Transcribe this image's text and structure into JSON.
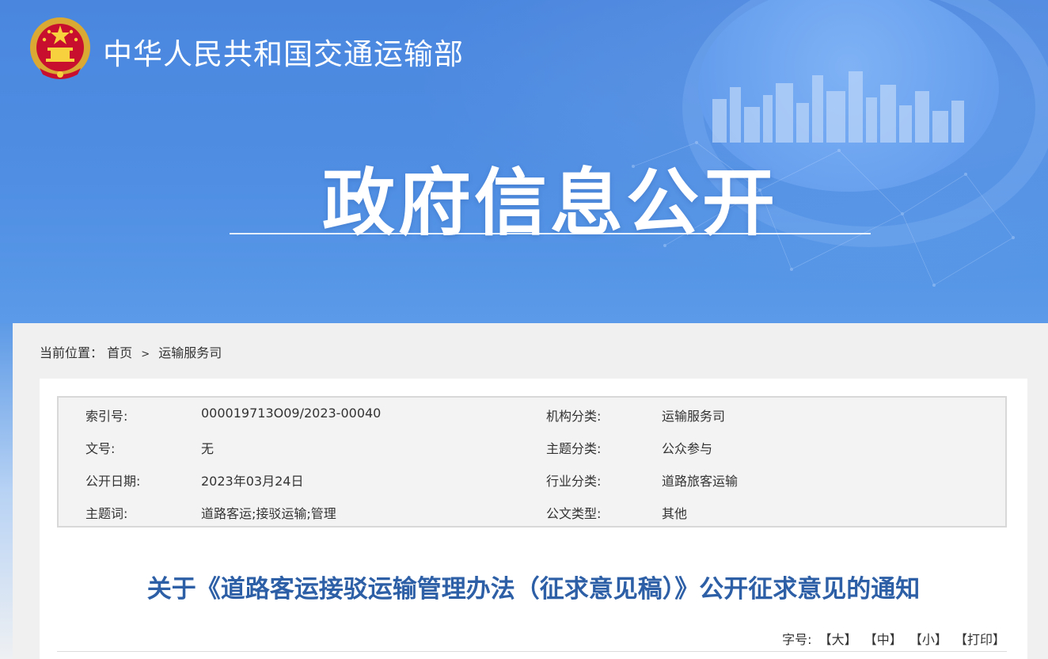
{
  "header": {
    "ministry_name": "中华人民共和国交通运输部",
    "banner_title": "政府信息公开",
    "emblem_icon": "national-emblem-icon",
    "colors": {
      "banner": "#4f8ee3",
      "title": "#2d5fa6"
    }
  },
  "breadcrumb": {
    "prefix": "当前位置：",
    "items": [
      "首页",
      "运输服务司"
    ],
    "separator": ">"
  },
  "metadata": {
    "rows": [
      {
        "label1": "索引号:",
        "value1": "000019713O09/2023-00040",
        "label2": "机构分类:",
        "value2": "运输服务司"
      },
      {
        "label1": "文号:",
        "value1": "无",
        "label2": "主题分类:",
        "value2": "公众参与"
      },
      {
        "label1": "公开日期:",
        "value1": "2023年03月24日",
        "label2": "行业分类:",
        "value2": "道路旅客运输"
      },
      {
        "label1": "主题词:",
        "value1": "道路客运;接驳运输;管理",
        "label2": "公文类型:",
        "value2": "其他"
      }
    ]
  },
  "article": {
    "title": "关于《道路客运接驳运输管理办法（征求意见稿）》公开征求意见的通知",
    "font_size_label": "字号:",
    "font_size_options": [
      "【大】",
      "【中】",
      "【小】",
      "【打印】"
    ]
  }
}
